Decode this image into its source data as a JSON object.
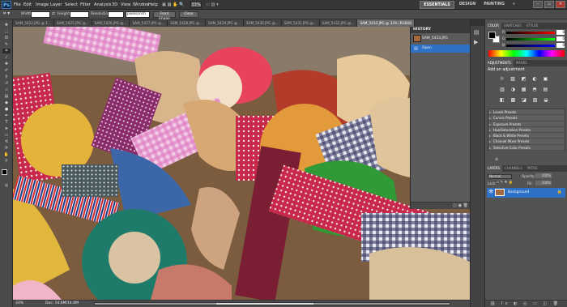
{
  "app": {
    "logo": "Ps"
  },
  "menu": [
    "File",
    "Edit",
    "Image",
    "Layer",
    "Select",
    "Filter",
    "Analysis",
    "3D",
    "View",
    "Window",
    "Help"
  ],
  "topicons": {
    "zoom": "33%"
  },
  "workspaces": [
    "ESSENTIALS",
    "DESIGN",
    "PAINTING"
  ],
  "window_controls": [
    "–",
    "▫",
    "✕"
  ],
  "options": {
    "width_label": "Width:",
    "height_label": "Height:",
    "resolution_label": "Resolution:",
    "unit": "pixels/inch",
    "front_image": "Front Image",
    "clear": "Clear"
  },
  "tabs": [
    "SAM_5422.JPG @ 1...",
    "SAM_5425.JPG @...",
    "SAM_5426.JPG @...",
    "SAM_5427.JPG @...",
    "SAM_5428.JPG @...",
    "SAM_5429.JPG @...",
    "SAM_5430.JPG @...",
    "SAM_5431.JPG @...",
    "SAM_5432.JPG @...",
    "SAM_5433.JPG @ 33% (RGB/8)"
  ],
  "status": {
    "zoom": "33%",
    "doc": "Doc: 14.6M/14.6M"
  },
  "history": {
    "title": "HISTORY",
    "snapshot": "SAM_5433.JPG",
    "items": [
      "Open"
    ]
  },
  "color_panel": {
    "tabs": [
      "COLOR",
      "SWATCHES",
      "STYLES"
    ],
    "channels": [
      "R",
      "G",
      "B"
    ],
    "values": [
      "0",
      "0",
      "0"
    ]
  },
  "adjustments": {
    "tabs": [
      "ADJUSTMENTS",
      "MASKS"
    ],
    "title": "Add an adjustment",
    "presets": [
      "Levels Presets",
      "Curves Presets",
      "Exposure Presets",
      "Hue/Saturation Presets",
      "Black & White Presets",
      "Channel Mixer Presets",
      "Selective Color Presets"
    ]
  },
  "layers": {
    "tabs": [
      "LAYERS",
      "CHANNELS",
      "PATHS"
    ],
    "blend": "Normal",
    "opacity_label": "Opacity:",
    "opacity": "100%",
    "lock_label": "Lock:",
    "fill_label": "Fill:",
    "fill": "100%",
    "items": [
      {
        "name": "Background"
      }
    ]
  }
}
